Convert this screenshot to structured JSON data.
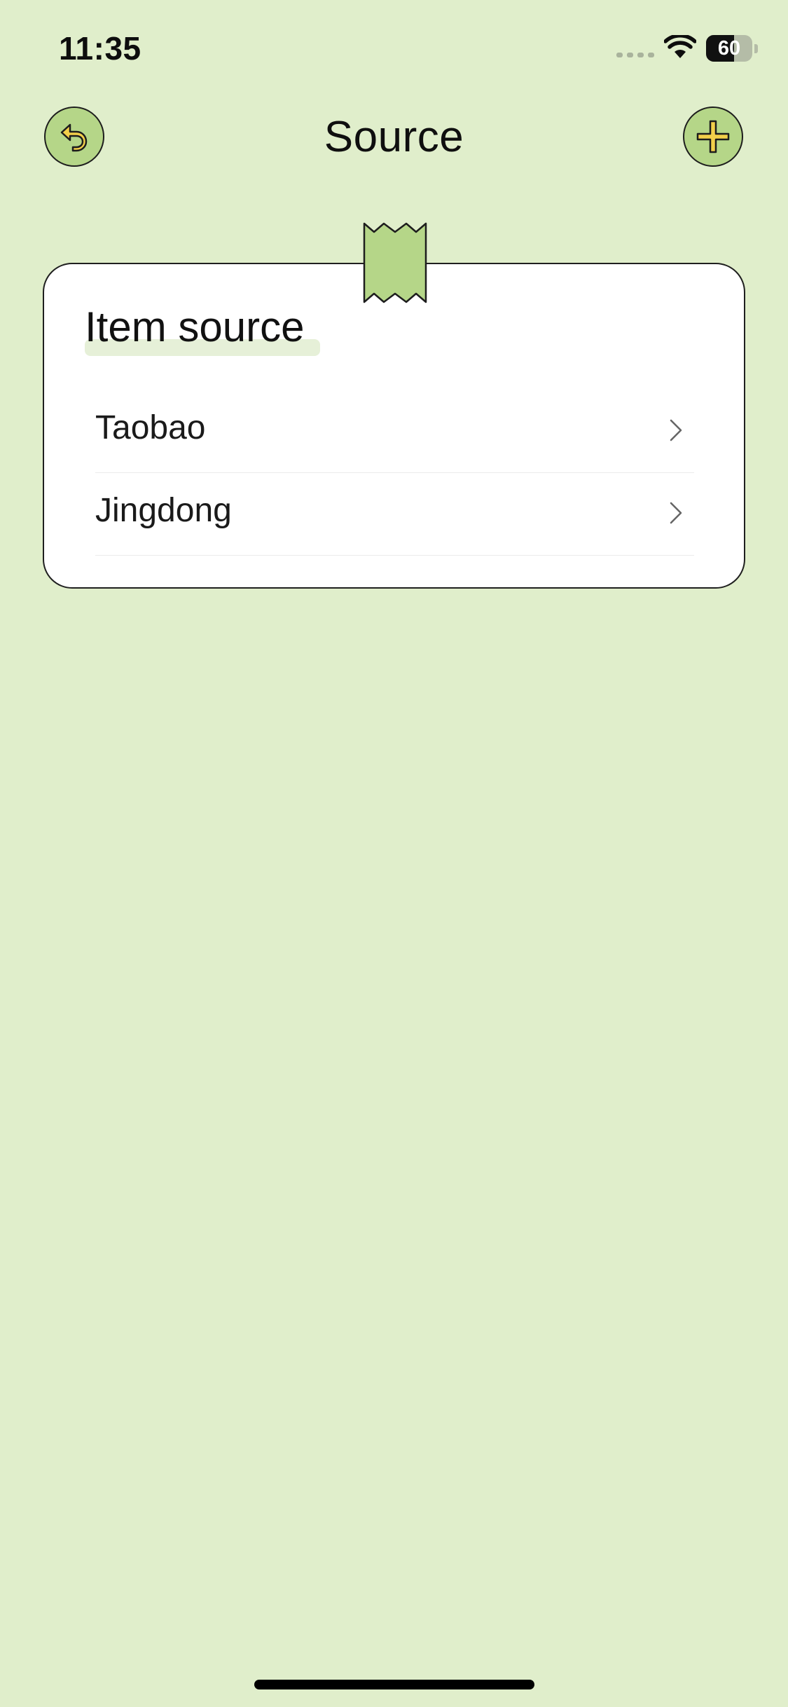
{
  "status_bar": {
    "time": "11:35",
    "battery_level": "60",
    "battery_fraction": 0.6,
    "icons": [
      "signal-dots-icon",
      "wifi-icon",
      "battery-icon"
    ]
  },
  "nav": {
    "title": "Source",
    "back_icon": "undo-arrow-icon",
    "add_icon": "plus-icon"
  },
  "card": {
    "title": "Item source",
    "decoration_icon": "washi-tape-icon",
    "items": [
      {
        "label": "Taobao",
        "icon": "chevron-right-icon"
      },
      {
        "label": "Jingdong",
        "icon": "chevron-right-icon"
      }
    ]
  },
  "colors": {
    "background": "#e0eecb",
    "accent_green": "#b5d688",
    "icon_yellow": "#f2cf4a",
    "card": "#ffffff",
    "outline": "#1f1f1f"
  }
}
